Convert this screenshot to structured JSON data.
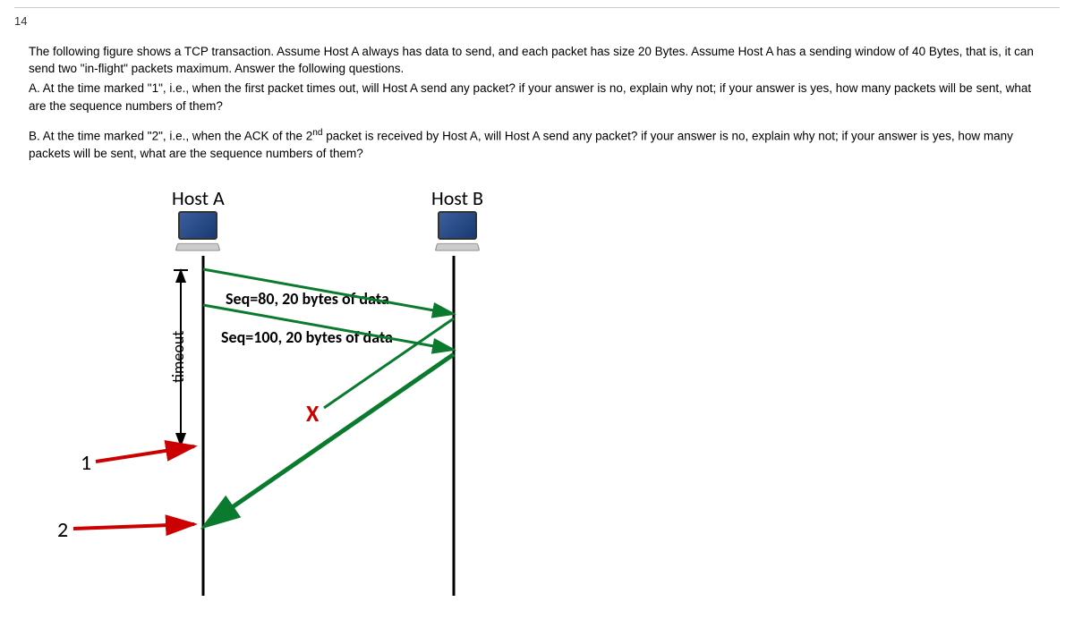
{
  "question": {
    "number": "14",
    "intro": "The following figure shows a TCP transaction. Assume Host A always has data to send, and each packet has size 20 Bytes. Assume Host A has a sending window of 40 Bytes, that is, it can send two \"in-flight\" packets maximum. Answer the following questions.",
    "partA": "A. At the time marked \"1\", i.e., when the first packet times out, will Host A send any packet? if your answer is no, explain why not; if your answer is yes, how many packets will be sent, what are the sequence numbers of them?",
    "partB_prefix": "B. At the time marked \"2\", i.e., when the ACK of the 2",
    "partB_sup": "nd",
    "partB_suffix": " packet is received by Host A, will Host A send any packet? if your answer is no, explain why not; if your answer is yes, how many packets will be sent, what are the sequence numbers of them?"
  },
  "diagram": {
    "hostA": "Host A",
    "hostB": "Host B",
    "seq1": "Seq=80, 20 bytes of data",
    "seq2": "Seq=100, 20 bytes of data",
    "lost": "X",
    "timeout": "timeout",
    "marker1": "1",
    "marker2": "2"
  }
}
